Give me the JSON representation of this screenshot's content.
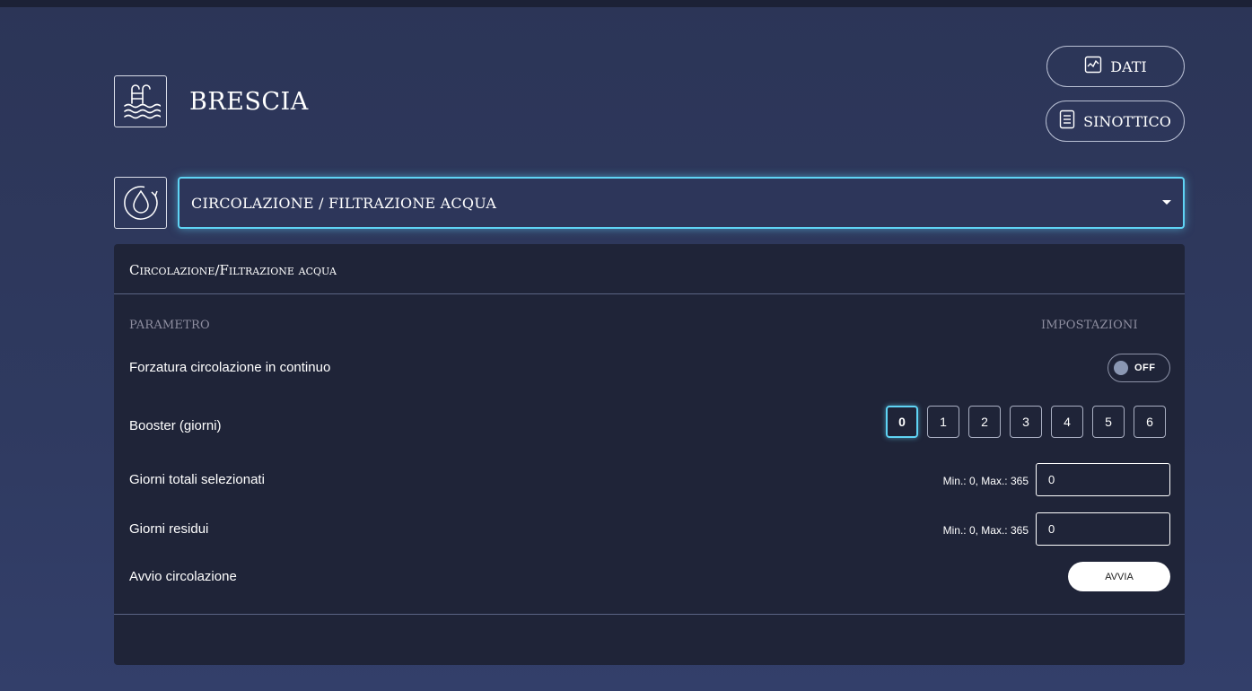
{
  "header": {
    "title": "BRESCIA",
    "icon": "pool-ladder-icon",
    "buttons": {
      "dati_label": "DATI",
      "dati_icon": "chart-icon",
      "sinottico_label": "SINOTTICO",
      "sinottico_icon": "document-icon"
    }
  },
  "section_select": {
    "icon": "water-drop-cycle-icon",
    "selected": "CIRCOLAZIONE / FILTRAZIONE ACQUA"
  },
  "panel": {
    "title": "Circolazione/Filtrazione acqua",
    "col_param": "PARAMETRO",
    "col_settings": "IMPOSTAZIONI",
    "rows": {
      "forzatura": {
        "label": "Forzatura circolazione in continuo",
        "toggle_text": "OFF"
      },
      "booster": {
        "label": "Booster (giorni)",
        "options": [
          "0",
          "1",
          "2",
          "3",
          "4",
          "5",
          "6"
        ],
        "selected": "0"
      },
      "giorni_totali": {
        "label": "Giorni totali selezionati",
        "range": "Min.: 0, Max.: 365",
        "value": "0"
      },
      "giorni_residui": {
        "label": "Giorni residui",
        "range": "Min.: 0, Max.: 365",
        "value": "0"
      },
      "avvio": {
        "label": "Avvio circolazione",
        "button_label": "AVVIA"
      }
    }
  },
  "colors": {
    "background": "#2f3a60",
    "panel": "#1f2438",
    "accent": "#5fd4f5"
  }
}
